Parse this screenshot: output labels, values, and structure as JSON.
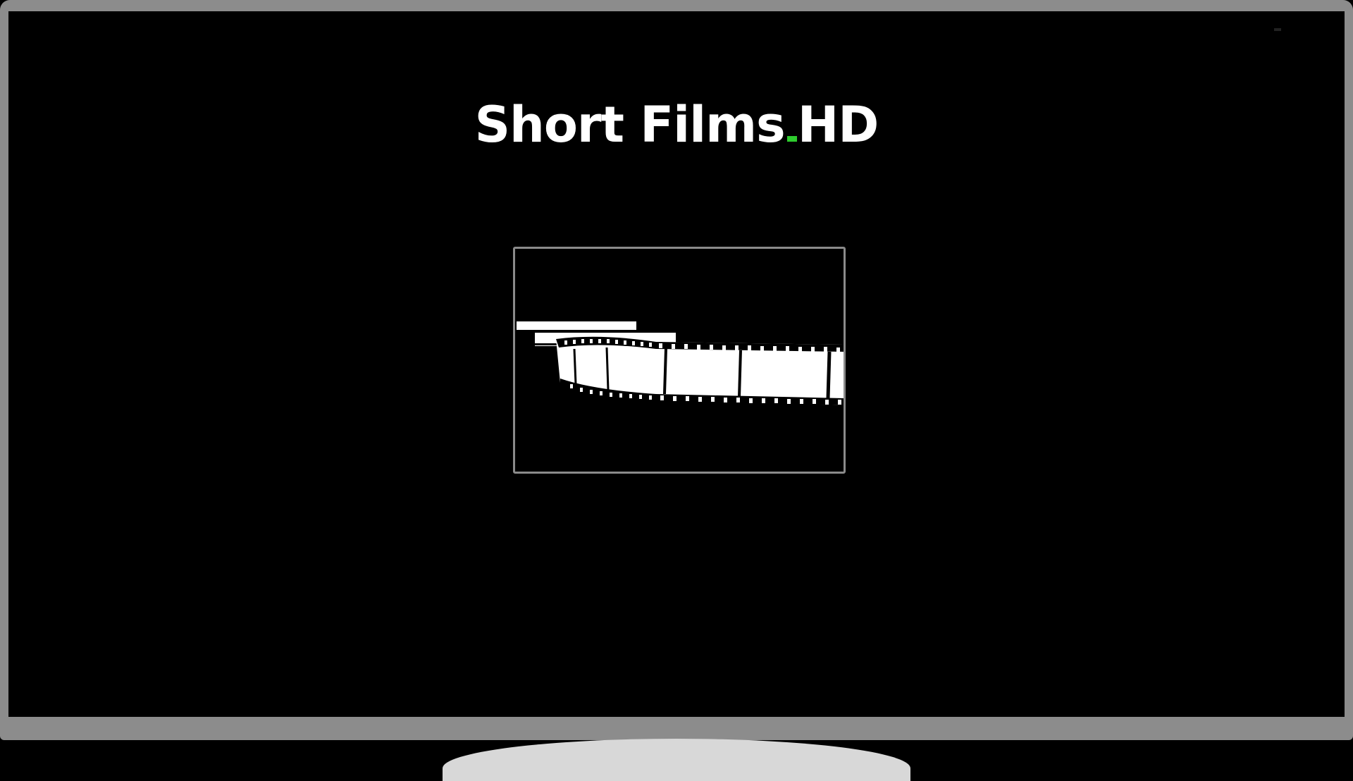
{
  "logo": {
    "part1": "Short Films",
    "part2": "HD",
    "dot_color": "#2ecc2e"
  },
  "preview": {
    "icon": "film-strip-icon"
  },
  "colors": {
    "bezel": "#8c8c8c",
    "screen": "#000000",
    "stand": "#d8d8d8",
    "accent": "#2ecc2e"
  }
}
